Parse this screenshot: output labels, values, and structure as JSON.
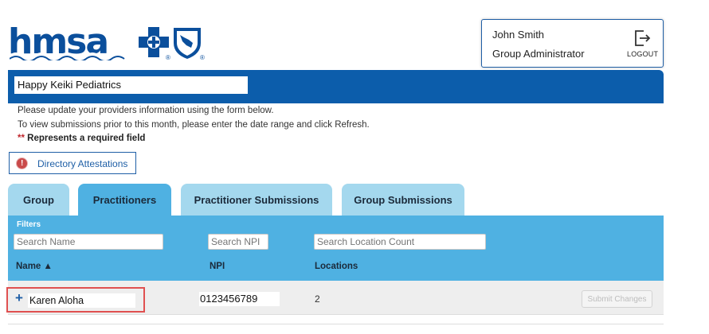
{
  "brand": {
    "logo_text": "hmsa",
    "reg_mark": "®",
    "brand_blue": "#0b4f9c",
    "accent_blue": "#0c5dab",
    "tab_active_color": "#4fb1e2",
    "tab_inactive_color": "#a4d8ee"
  },
  "user": {
    "name": "John Smith",
    "role": "Group Administrator",
    "logout_label": "LOGOUT",
    "logout_icon": "logout-icon"
  },
  "practice": {
    "name": "Happy Keiki Pediatrics"
  },
  "info": {
    "line1": "Please update your providers information using the form below.",
    "line2": "To view submissions prior to this month, please enter the date range and click Refresh.",
    "required_stars": "**",
    "required_text": " Represents a required field"
  },
  "attestations": {
    "label": "Directory Attestations",
    "icon": "alert-icon",
    "icon_glyph": "!"
  },
  "tabs": [
    {
      "label": "Group",
      "active": false
    },
    {
      "label": "Practitioners",
      "active": true
    },
    {
      "label": "Practitioner Submissions",
      "active": false
    },
    {
      "label": "Group Submissions",
      "active": false
    }
  ],
  "filters": {
    "label": "Filters",
    "name_placeholder": "Search Name",
    "npi_placeholder": "Search NPI",
    "location_placeholder": "Search Location Count"
  },
  "table": {
    "columns": {
      "name": "Name ▲",
      "npi": "NPI",
      "locations": "Locations"
    },
    "rows": [
      {
        "expand_glyph": "+",
        "name": "Karen Aloha",
        "npi": "0123456789",
        "locations": "2",
        "submit_label": "Submit Changes"
      }
    ]
  }
}
